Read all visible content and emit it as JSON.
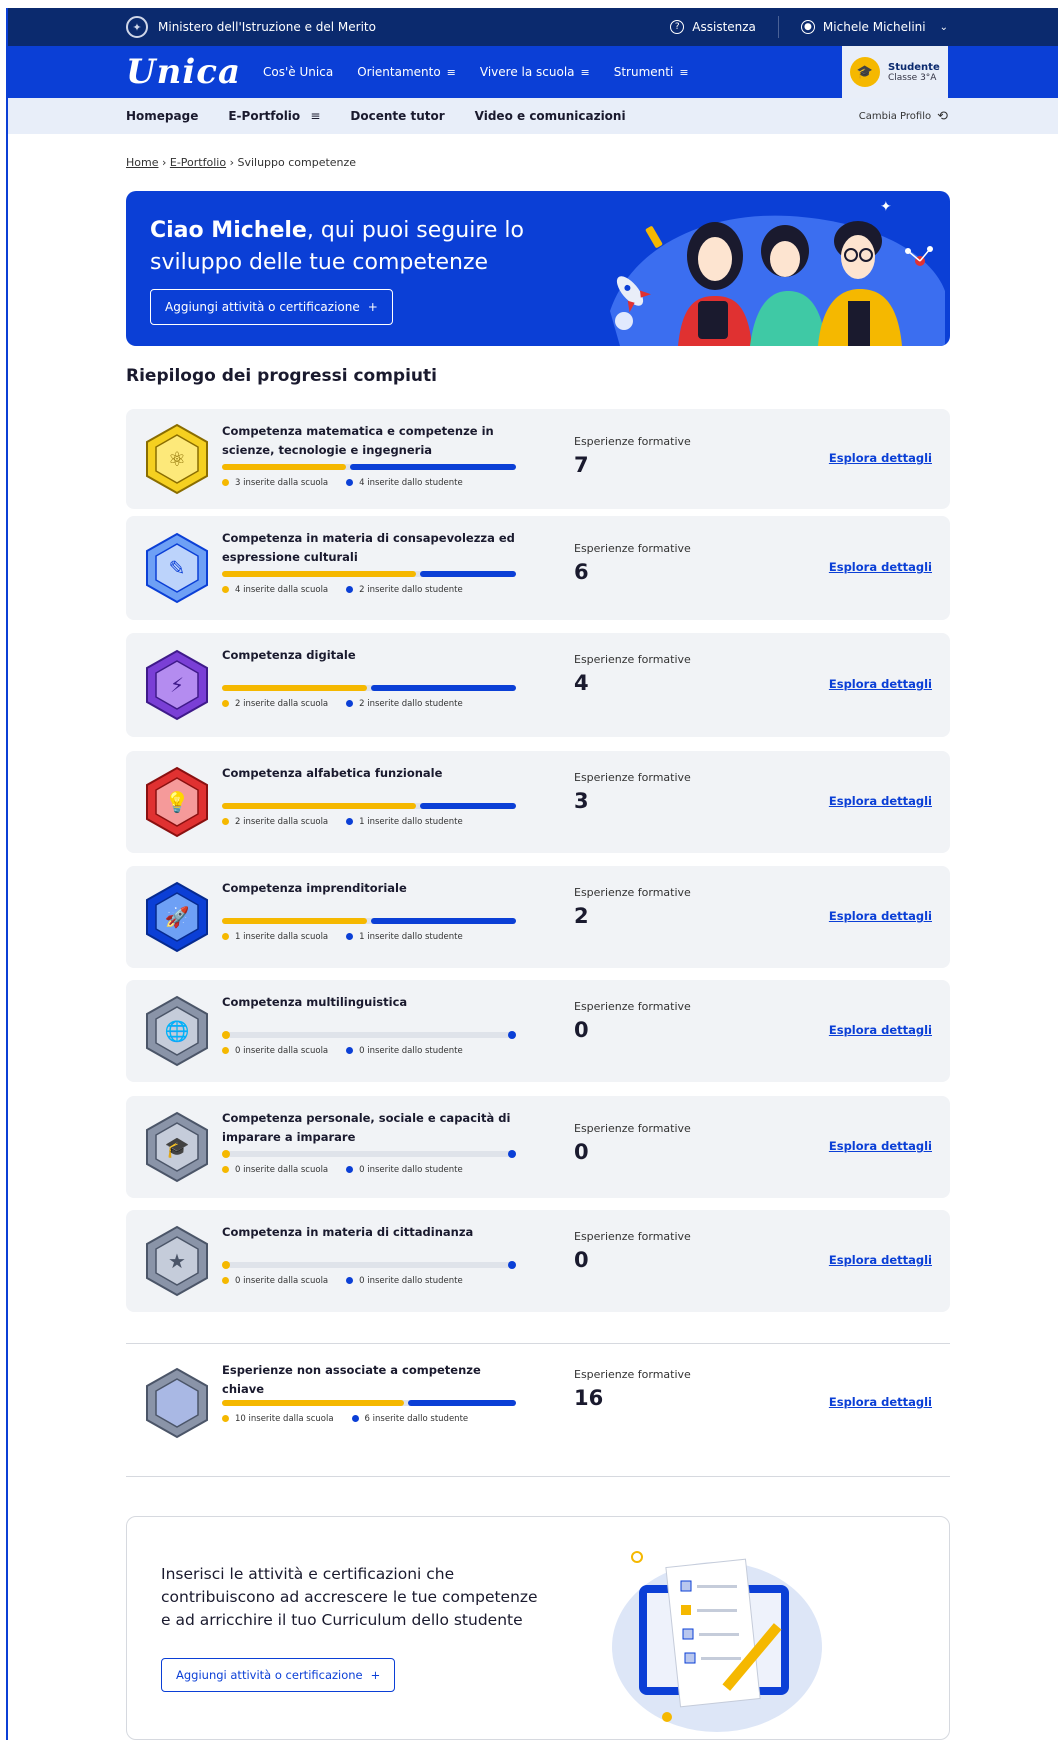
{
  "topbar": {
    "ministry": "Ministero dell'Istruzione e del Merito",
    "assistance": "Assistenza",
    "user": "Michele Michelini"
  },
  "mainnav": {
    "logo": "Unica",
    "items": [
      "Cos'è Unica",
      "Orientamento",
      "Vivere la scuola",
      "Strumenti"
    ],
    "profile_role": "Studente",
    "profile_class": "Classe 3°A"
  },
  "subnav": {
    "items": [
      "Homepage",
      "E-Portfolio",
      "Docente tutor",
      "Video e comunicazioni"
    ],
    "change_profile": "Cambia Profilo"
  },
  "breadcrumb": {
    "home": "Home",
    "eportfolio": "E-Portfolio",
    "current": "Sviluppo competenze"
  },
  "hero": {
    "greeting_name": "Ciao Michele",
    "greeting_rest": ", qui puoi seguire lo sviluppo delle tue competenze",
    "button": "Aggiungi attività o certificazione"
  },
  "summary_title": "Riepilogo dei progressi compiuti",
  "exp_label": "Esperienze formative",
  "explore_label": "Esplora dettagli",
  "colors": {
    "primary": "#0b3fd6",
    "school": "#f5b800",
    "student": "#0b3fd6"
  },
  "competences": [
    {
      "name": "Competenza matematica e competenze in scienze, tecnologie e ingegneria",
      "school_label": "3 inserite dalla scuola",
      "student_label": "4 inserite dallo studente",
      "school": 3,
      "student": 4,
      "total": "7",
      "icon": "atom-icon"
    },
    {
      "name": "Competenza in materia di consapevolezza ed espressione culturali",
      "school_label": "4 inserite dalla scuola",
      "student_label": "2 inserite dallo studente",
      "school": 4,
      "student": 2,
      "total": "6",
      "icon": "easel-icon"
    },
    {
      "name": "Competenza digitale",
      "school_label": "2 inserite dalla scuola",
      "student_label": "2 inserite dallo studente",
      "school": 2,
      "student": 2,
      "total": "4",
      "icon": "computer-icon"
    },
    {
      "name": "Competenza alfabetica funzionale",
      "school_label": "2 inserite dalla scuola",
      "student_label": "1 inserite dallo studente",
      "school": 2,
      "student": 1,
      "total": "3",
      "icon": "lightbulb-icon"
    },
    {
      "name": "Competenza imprenditoriale",
      "school_label": "1 inserite dalla scuola",
      "student_label": "1 inserite dallo studente",
      "school": 1,
      "student": 1,
      "total": "2",
      "icon": "rocket-icon"
    },
    {
      "name": "Competenza multilinguistica",
      "school_label": "0 inserite dalla scuola",
      "student_label": "0 inserite dallo studente",
      "school": 0,
      "student": 0,
      "total": "0",
      "icon": "globe-icon"
    },
    {
      "name": "Competenza personale, sociale e capacità di imparare a imparare",
      "school_label": "0 inserite dalla scuola",
      "student_label": "0 inserite dallo studente",
      "school": 0,
      "student": 0,
      "total": "0",
      "icon": "graduation-icon"
    },
    {
      "name": "Competenza in materia di cittadinanza",
      "school_label": "0 inserite dalla scuola",
      "student_label": "0 inserite dallo studente",
      "school": 0,
      "student": 0,
      "total": "0",
      "icon": "medal-icon"
    }
  ],
  "unassociated": {
    "name": "Esperienze non associate a competenze chiave",
    "school_label": "10 inserite dalla scuola",
    "student_label": "6 inserite dallo studente",
    "school": 10,
    "student": 6,
    "total": "16"
  },
  "bottom": {
    "text": "Inserisci le attività e certificazioni che contribuiscono ad accrescere le tue competenze e ad arricchire il tuo Curriculum dello studente",
    "button": "Aggiungi attività o certificazione"
  }
}
